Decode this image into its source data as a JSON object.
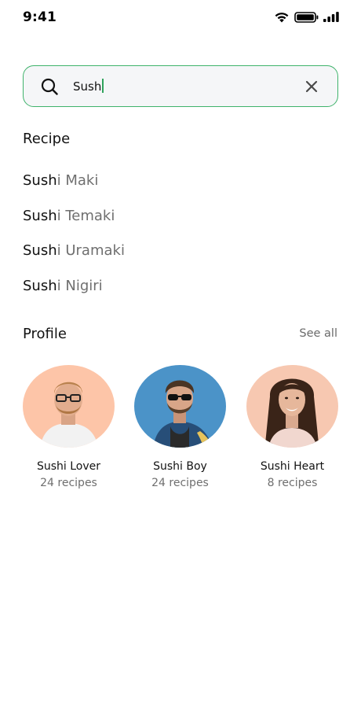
{
  "status_bar": {
    "time": "9:41",
    "icons": [
      "wifi-icon",
      "battery-icon",
      "signal-icon"
    ]
  },
  "search": {
    "value": "Sush",
    "icon": "search-icon",
    "clear_icon": "close-icon",
    "accent_color": "#3fb36b"
  },
  "recipe_section": {
    "title": "Recipe",
    "items": [
      {
        "match": "Sush",
        "rest": "i Maki"
      },
      {
        "match": "Sush",
        "rest": "i Temaki"
      },
      {
        "match": "Sush",
        "rest": "i Uramaki"
      },
      {
        "match": "Sush",
        "rest": "i Nigiri"
      }
    ]
  },
  "profile_section": {
    "title": "Profile",
    "see_all": "See all",
    "profiles": [
      {
        "name": "Sushi Lover",
        "count": "24 recipes",
        "bg": "#fdc5a8"
      },
      {
        "name": "Sushi Boy",
        "count": "24 recipes",
        "bg": "#4b93c8"
      },
      {
        "name": "Sushi Heart",
        "count": "8 recipes",
        "bg": "#f7c8b1"
      }
    ]
  }
}
